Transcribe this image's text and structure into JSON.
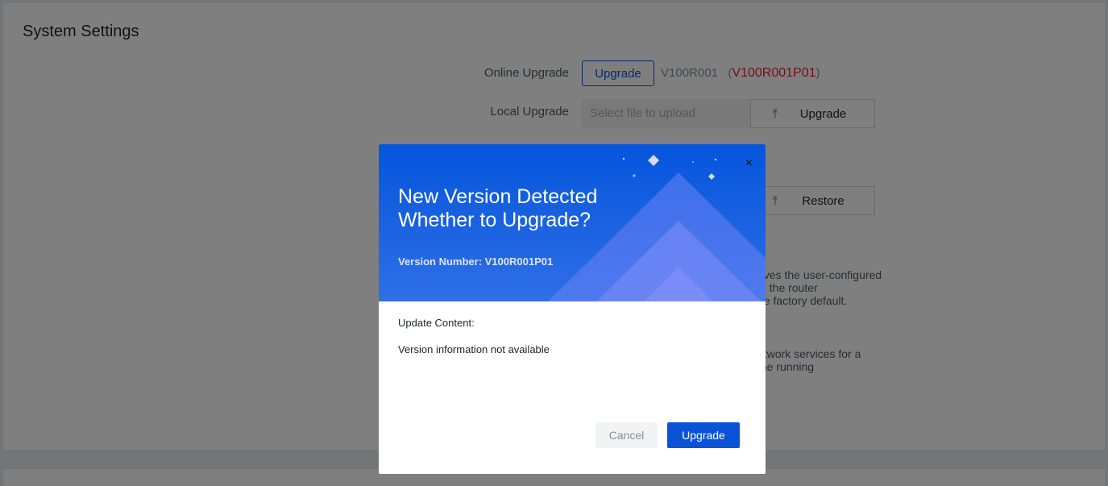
{
  "page": {
    "title": "System Settings"
  },
  "online_upgrade": {
    "label": "Online Upgrade",
    "button": "Upgrade",
    "current_version": "V100R001",
    "new_version": "V100R001P01"
  },
  "local_upgrade": {
    "label": "Local Upgrade",
    "placeholder": "Select file to upload",
    "button": "Upgrade",
    "icon": "upload-icon"
  },
  "restore": {
    "button": "Restore",
    "icon": "upload-icon"
  },
  "background_fragments": {
    "factory": [
      "oves the user-configured",
      "ip the router",
      "he factory default."
    ],
    "restart": [
      "etwork services for a",
      "the running"
    ]
  },
  "modal": {
    "title_line1": "New Version Detected",
    "title_line2": "Whether to Upgrade?",
    "version_number": "Version Number: V100R001P01",
    "close": "×",
    "content_label": "Update Content:",
    "content": "Version information not available",
    "cancel": "Cancel",
    "upgrade": "Upgrade",
    "accent": "#0a53d6"
  }
}
